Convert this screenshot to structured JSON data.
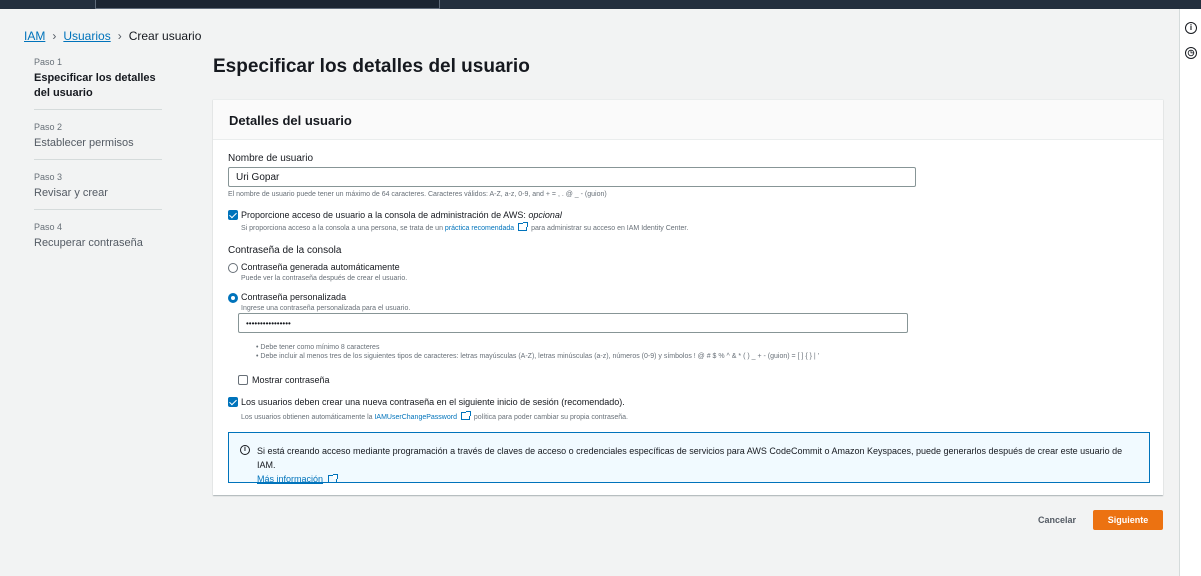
{
  "breadcrumb": {
    "iam": "IAM",
    "users": "Usuarios",
    "current": "Crear usuario"
  },
  "steps": [
    {
      "num": "Paso 1",
      "label": "Especificar los detalles del usuario"
    },
    {
      "num": "Paso 2",
      "label": "Establecer permisos"
    },
    {
      "num": "Paso 3",
      "label": "Revisar y crear"
    },
    {
      "num": "Paso 4",
      "label": "Recuperar contraseña"
    }
  ],
  "page_title": "Especificar los detalles del usuario",
  "panel": {
    "header": "Detalles del usuario",
    "username_label": "Nombre de usuario",
    "username_value": "Uri Gopar",
    "username_hint": "El nombre de usuario puede tener un máximo de 64 caracteres. Caracteres válidos: A-Z, a-z, 0-9, and + = , . @ _ - (guion)",
    "console_access_label": "Proporcione acceso de usuario a la consola de administración de AWS:",
    "console_access_optional": "opcional",
    "console_access_hint_pre": "Si proporciona acceso a la consola a una persona, se trata de un",
    "console_access_hint_link": "práctica recomendada",
    "console_access_hint_post": "para administrar su acceso en IAM Identity Center.",
    "console_password_label": "Contraseña de la consola",
    "auto_password_label": "Contraseña generada automáticamente",
    "auto_password_hint": "Puede ver la contraseña después de crear el usuario.",
    "custom_password_label": "Contraseña personalizada",
    "custom_password_hint": "Ingrese una contraseña personalizada para el usuario.",
    "password_value": "••••••••••••••••",
    "rules": [
      "• Debe tener como mínimo 8 caracteres",
      "• Debe incluir al menos tres de los siguientes tipos de caracteres: letras mayúsculas (A-Z), letras minúsculas (a-z), números (0-9) y símbolos ! @ # $ % ^ & * ( ) _ + - (guion) = [ ] { } | '"
    ],
    "show_password_label": "Mostrar contraseña",
    "reset_label": "Los usuarios deben crear una nueva contraseña en el siguiente inicio de sesión (recomendado).",
    "reset_hint_pre": "Los usuarios obtienen automáticamente la",
    "reset_hint_link": "IAMUserChangePassword",
    "reset_hint_post": "política para poder cambiar su propia contraseña."
  },
  "info": {
    "text": "Si está creando acceso mediante programación a través de claves de acceso o credenciales específicas de servicios para AWS CodeCommit o Amazon Keyspaces, puede generarlos después de crear este usuario de IAM.",
    "link": "Más información"
  },
  "buttons": {
    "cancel": "Cancelar",
    "next": "Siguiente"
  },
  "colors": {
    "accent": "#0073bb",
    "primary_button": "#ec7211",
    "topbar": "#232f3e"
  },
  "icons": [
    "info-icon",
    "external-link-icon",
    "checkbox-checked-icon",
    "radio-icon"
  ]
}
